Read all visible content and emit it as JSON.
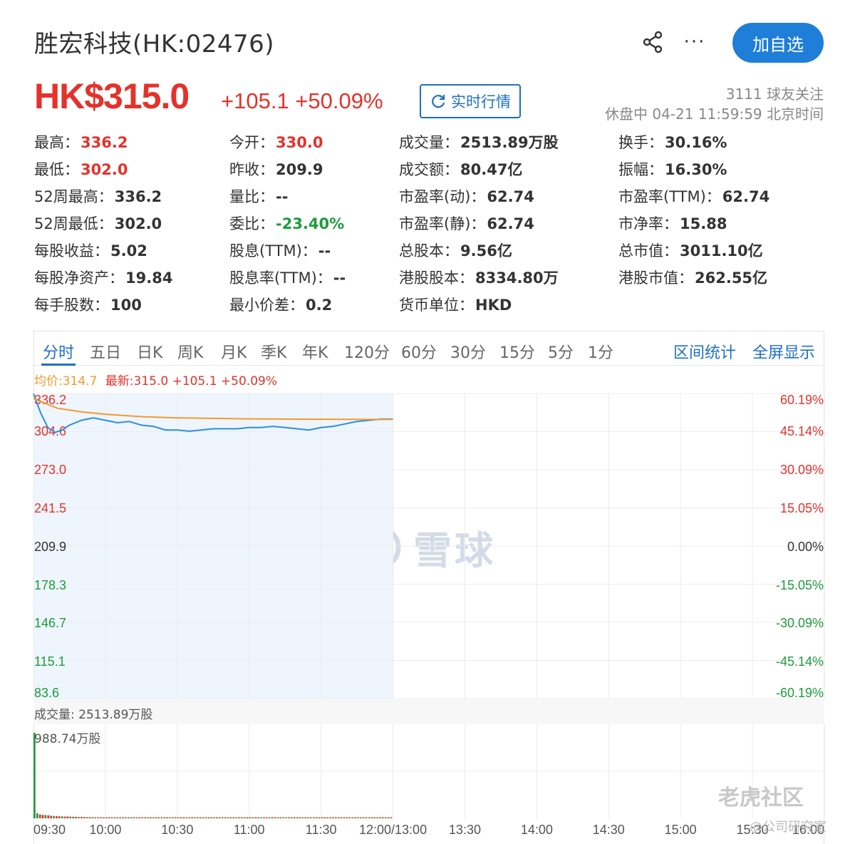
{
  "header": {
    "title": "胜宏科技(HK:02476)",
    "follow_label": "加自选",
    "more_label": "···"
  },
  "quote": {
    "price": "HK$315.0",
    "change": "+105.1 +50.09%",
    "realtime_label": "实时行情",
    "followers": "3111 球友关注",
    "status": "休盘中 04-21 11:59:59 北京时间"
  },
  "stats": [
    [
      {
        "k": "最高：",
        "v": "336.2",
        "c": "red"
      },
      {
        "k": "最低：",
        "v": "302.0",
        "c": "red"
      },
      {
        "k": "52周最高：",
        "v": "336.2",
        "c": ""
      },
      {
        "k": "52周最低：",
        "v": "302.0",
        "c": ""
      },
      {
        "k": "每股收益：",
        "v": "5.02",
        "c": ""
      },
      {
        "k": "每股净资产：",
        "v": "19.84",
        "c": ""
      },
      {
        "k": "每手股数：",
        "v": "100",
        "c": ""
      }
    ],
    [
      {
        "k": "今开：",
        "v": "330.0",
        "c": "red"
      },
      {
        "k": "昨收：",
        "v": "209.9",
        "c": ""
      },
      {
        "k": "量比：",
        "v": "--",
        "c": ""
      },
      {
        "k": "委比：",
        "v": "-23.40%",
        "c": "green"
      },
      {
        "k": "股息(TTM)：",
        "v": "--",
        "c": ""
      },
      {
        "k": "股息率(TTM)：",
        "v": "--",
        "c": ""
      },
      {
        "k": "最小价差：",
        "v": "0.2",
        "c": ""
      }
    ],
    [
      {
        "k": "成交量：",
        "v": "2513.89万股",
        "c": ""
      },
      {
        "k": "成交额：",
        "v": "80.47亿",
        "c": ""
      },
      {
        "k": "市盈率(动)：",
        "v": "62.74",
        "c": ""
      },
      {
        "k": "市盈率(静)：",
        "v": "62.74",
        "c": ""
      },
      {
        "k": "总股本：",
        "v": "9.56亿",
        "c": ""
      },
      {
        "k": "港股股本：",
        "v": "8334.80万",
        "c": ""
      },
      {
        "k": "货币单位：",
        "v": "HKD",
        "c": ""
      }
    ],
    [
      {
        "k": "换手：",
        "v": "30.16%",
        "c": ""
      },
      {
        "k": "振幅：",
        "v": "16.30%",
        "c": ""
      },
      {
        "k": "市盈率(TTM)：",
        "v": "62.74",
        "c": ""
      },
      {
        "k": "市净率：",
        "v": "15.88",
        "c": ""
      },
      {
        "k": "总市值：",
        "v": "3011.10亿",
        "c": ""
      },
      {
        "k": "港股市值：",
        "v": "262.55亿",
        "c": ""
      }
    ]
  ],
  "tabs": [
    "分时",
    "五日",
    "日K",
    "周K",
    "月K",
    "季K",
    "年K",
    "120分",
    "60分",
    "30分",
    "15分",
    "5分",
    "1分"
  ],
  "tabs_right": [
    "区间统计",
    "全屏显示"
  ],
  "legend": {
    "avg": "均价:314.7",
    "latest": "最新:315.0 +105.1 +50.09%"
  },
  "colors": {
    "up": "#e4322b",
    "down": "#1e9b3c",
    "accent": "#1e6fc8",
    "avg_line": "#f29a2e",
    "price_line": "#2b8fe0"
  },
  "chart_data": {
    "type": "line",
    "y_left_ticks": [
      "336.2",
      "304.6",
      "273.0",
      "241.5",
      "209.9",
      "178.3",
      "146.7",
      "115.1",
      "83.6"
    ],
    "y_right_ticks": [
      "60.19%",
      "45.14%",
      "30.09%",
      "15.05%",
      "0.00%",
      "-15.05%",
      "-30.09%",
      "-45.14%",
      "-60.19%"
    ],
    "ylim": [
      83.6,
      336.2
    ],
    "prev_close": 209.9,
    "x_ticks": [
      "09:30",
      "10:00",
      "10:30",
      "11:00",
      "11:30",
      "12:00/13:00",
      "13:30",
      "14:00",
      "14:30",
      "15:00",
      "15:30",
      "16:00"
    ],
    "series": [
      {
        "name": "price",
        "x": [
          "09:30",
          "09:33",
          "09:36",
          "09:39",
          "09:42",
          "09:45",
          "09:50",
          "09:55",
          "10:00",
          "10:05",
          "10:10",
          "10:15",
          "10:20",
          "10:25",
          "10:30",
          "10:35",
          "10:40",
          "10:45",
          "10:50",
          "10:55",
          "11:00",
          "11:05",
          "11:10",
          "11:15",
          "11:20",
          "11:25",
          "11:30",
          "11:35",
          "11:40",
          "11:45",
          "11:50",
          "11:55",
          "12:00"
        ],
        "values": [
          336.0,
          320.0,
          308.0,
          304.0,
          306.0,
          310.0,
          314.0,
          316.0,
          314.0,
          312.0,
          313.0,
          310.0,
          309.0,
          306.0,
          306.0,
          305.0,
          306.0,
          307.0,
          307.0,
          307.0,
          308.0,
          308.0,
          309.0,
          308.0,
          307.0,
          306.0,
          308.0,
          309.0,
          311.0,
          313.0,
          314.0,
          315.0,
          315.0
        ]
      },
      {
        "name": "avg",
        "x": [
          "09:30",
          "09:40",
          "09:50",
          "10:00",
          "10:15",
          "10:30",
          "10:45",
          "11:00",
          "11:15",
          "11:30",
          "11:45",
          "12:00"
        ],
        "values": [
          332.0,
          324.0,
          321.0,
          319.0,
          317.0,
          316.0,
          315.6,
          315.2,
          315.0,
          314.9,
          314.8,
          314.7
        ]
      }
    ],
    "volume": {
      "label": "成交量: 2513.89万股",
      "max_label": "988.74万股",
      "max": 988.74,
      "values": [
        988.74,
        60,
        45,
        40,
        38,
        35,
        30,
        28,
        26,
        24,
        22,
        20,
        22,
        20,
        18,
        18,
        16,
        16,
        15,
        14,
        14,
        13,
        12,
        12,
        12,
        11,
        11,
        10,
        10,
        10,
        9,
        9,
        9,
        9,
        8,
        8,
        8,
        8,
        8,
        8,
        7,
        7,
        7,
        7,
        7,
        6,
        6,
        6,
        6,
        6,
        6,
        6,
        6,
        6,
        6,
        6,
        6,
        6,
        6,
        6,
        6,
        6,
        6,
        6,
        6,
        5,
        5,
        5,
        5,
        5,
        5,
        5,
        5,
        5,
        5,
        5,
        5,
        5,
        5,
        5,
        5,
        5,
        5,
        5,
        5,
        5,
        5,
        5,
        5,
        5,
        5,
        5,
        5,
        5,
        5,
        5,
        5,
        5,
        5,
        5,
        5,
        5,
        5,
        5,
        5,
        5,
        5,
        5,
        5,
        5,
        5,
        5,
        5,
        5,
        5,
        5,
        5,
        5,
        5,
        5,
        5,
        5,
        5,
        5,
        5,
        5,
        5,
        5,
        5,
        5
      ],
      "colors_up_down": "alternating"
    }
  },
  "watermarks": {
    "main": "雪球",
    "corner": "老虎社区",
    "corner_sub": "@公司研究室"
  }
}
